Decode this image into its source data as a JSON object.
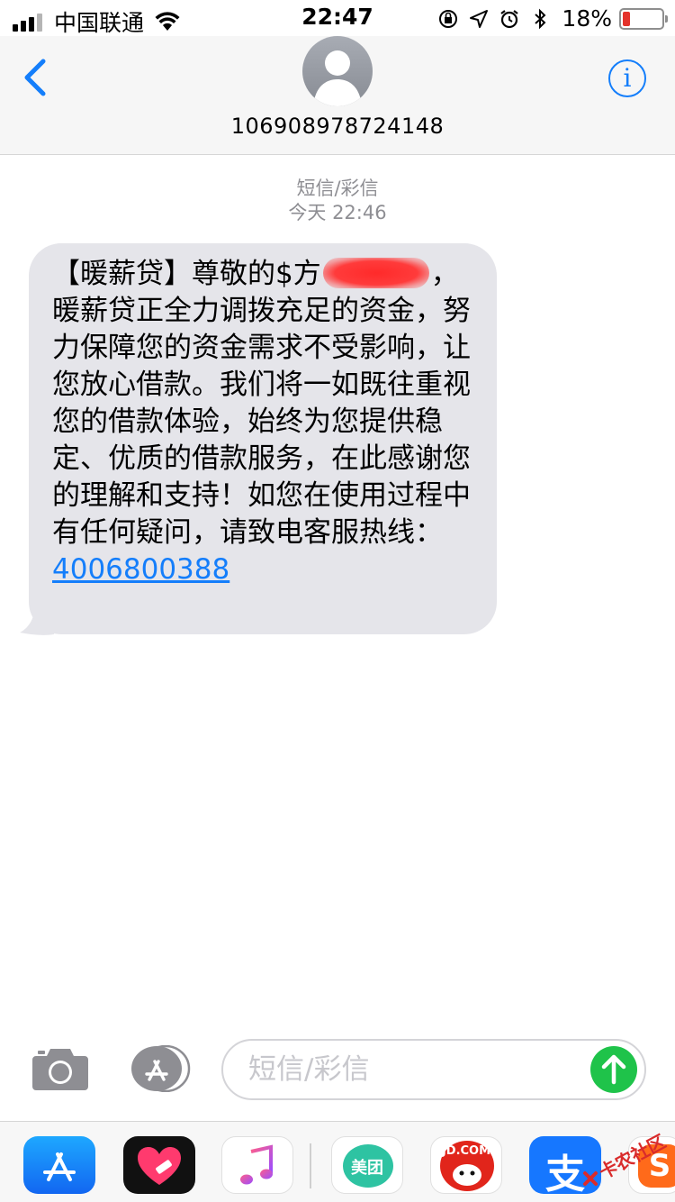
{
  "status_bar": {
    "carrier": "中国联通",
    "time": "22:47",
    "battery_percent": "18%",
    "battery_level": 0.18
  },
  "header": {
    "contact": "106908978724148"
  },
  "conversation": {
    "type_label": "短信/彩信",
    "timestamp": "今天 22:46",
    "message": {
      "text_before": "【暖薪贷】尊敬的$",
      "redacted_visible": "方",
      "text_after": "，暖薪贷正全力调拨充足的资金，努力保障您的资金需求不受影响，让您放心借款。我们将一如既往重视您的借款体验，始终为您提供稳定、优质的借款服务，在此感谢您的理解和支持！如您在使用过程中有任何疑问，请致电客服热线：",
      "phone_link": "4006800388"
    }
  },
  "composer": {
    "placeholder": "短信/彩信"
  },
  "app_drawer": {
    "meituan_label": "美团",
    "jd_label": "JD.COM",
    "alipay_label": "支",
    "watermark_text": "卡农社区"
  },
  "colors": {
    "accent_blue": "#147efb",
    "bubble_gray": "#e5e5ea",
    "send_green": "#1fc34a",
    "redaction_red": "#ff2a2a"
  }
}
